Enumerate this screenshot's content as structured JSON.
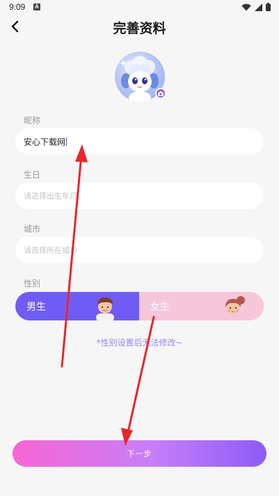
{
  "status_bar": {
    "time": "9:09",
    "a_icon": "A"
  },
  "header": {
    "title": "完善资料"
  },
  "form": {
    "nickname_label": "昵称",
    "nickname_value": "安心下载网",
    "birthday_label": "生日",
    "birthday_placeholder": "请选择出生年月",
    "city_label": "城市",
    "city_placeholder": "请选择所在城市",
    "gender_label": "性别",
    "gender_male": "男生",
    "gender_female": "女生",
    "gender_selected": "男生",
    "gender_hint": "*性别设置后无法修改~"
  },
  "footer": {
    "next_label": "下一步"
  },
  "icons": {
    "back": "chevron-left-icon",
    "camera": "camera-icon",
    "wifi": "wifi-icon",
    "signal": "signal-icon",
    "battery": "battery-icon"
  },
  "colors": {
    "accent": "#6f5cf6",
    "female": "#f6c6da",
    "hint": "#9a86f2",
    "annotation": "#e8262c"
  }
}
